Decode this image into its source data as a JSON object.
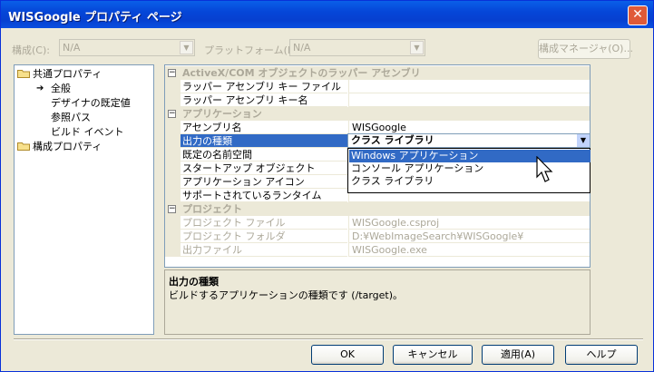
{
  "window": {
    "title": "WISGoogle プロパティ ページ",
    "close_glyph": "✕"
  },
  "config": {
    "config_label": "構成(C):",
    "config_value": "N/A",
    "platform_label": "プラットフォーム(P):",
    "platform_value": "N/A",
    "manager_button": "構成マネージャ(O)..."
  },
  "tree": {
    "common": "共通プロパティ",
    "items": [
      "全般",
      "デザイナの既定値",
      "参照パス",
      "ビルド イベント"
    ],
    "config_props": "構成プロパティ",
    "pointer_glyph": "➔"
  },
  "grid": {
    "categories": {
      "activex": "ActiveX/COM オブジェクトのラッパー アセンブリ",
      "application": "アプリケーション",
      "project": "プロジェクト"
    },
    "activex_rows": [
      {
        "name": "ラッパー アセンブリ キー ファイル",
        "value": ""
      },
      {
        "name": "ラッパー アセンブリ キー名",
        "value": ""
      }
    ],
    "application_rows": [
      {
        "name": "アセンブリ名",
        "value": "WISGoogle"
      },
      {
        "name": "出力の種類",
        "value": "クラス ライブラリ"
      },
      {
        "name": "既定の名前空間",
        "value": ""
      },
      {
        "name": "スタートアップ オブジェクト",
        "value": ""
      },
      {
        "name": "アプリケーション アイコン",
        "value": ""
      },
      {
        "name": "サポートされているランタイム",
        "value": ""
      }
    ],
    "project_rows": [
      {
        "name": "プロジェクト ファイル",
        "value": "WISGoogle.csproj"
      },
      {
        "name": "プロジェクト フォルダ",
        "value": "D:¥WebImageSearch¥WISGoogle¥"
      },
      {
        "name": "出力ファイル",
        "value": "WISGoogle.exe"
      }
    ],
    "collapse_glyph": "−",
    "dropdown_arrow": "▼",
    "dropdown_options": [
      "Windows アプリケーション",
      "コンソール アプリケーション",
      "クラス ライブラリ"
    ]
  },
  "description": {
    "title": "出力の種類",
    "text": "ビルドするアプリケーションの種類です (/target)。"
  },
  "buttons": {
    "ok": "OK",
    "cancel": "キャンセル",
    "apply": "適用(A)",
    "help": "ヘルプ"
  },
  "colors": {
    "titlebar": "#0546d8",
    "selection": "#316ac5",
    "face": "#ece9d8"
  },
  "icons": [
    "folder-icon",
    "arrow-pointer-icon",
    "mouse-cursor-icon",
    "close-icon"
  ]
}
